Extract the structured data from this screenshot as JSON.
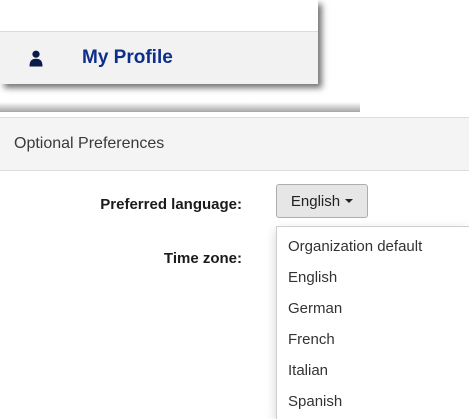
{
  "profile_menu": {
    "item_label": "My Profile",
    "icon": "user-icon"
  },
  "preferences": {
    "section_title": "Optional Preferences",
    "language_label": "Preferred language:",
    "language_selected": "English",
    "timezone_label": "Time zone:",
    "language_options": [
      "Organization default",
      "English",
      "German",
      "French",
      "Italian",
      "Spanish"
    ]
  },
  "colors": {
    "profile_text": "#0e2e8c",
    "menu_item_bg": "#f2f2f2",
    "header_bg": "#f4f4f4"
  }
}
